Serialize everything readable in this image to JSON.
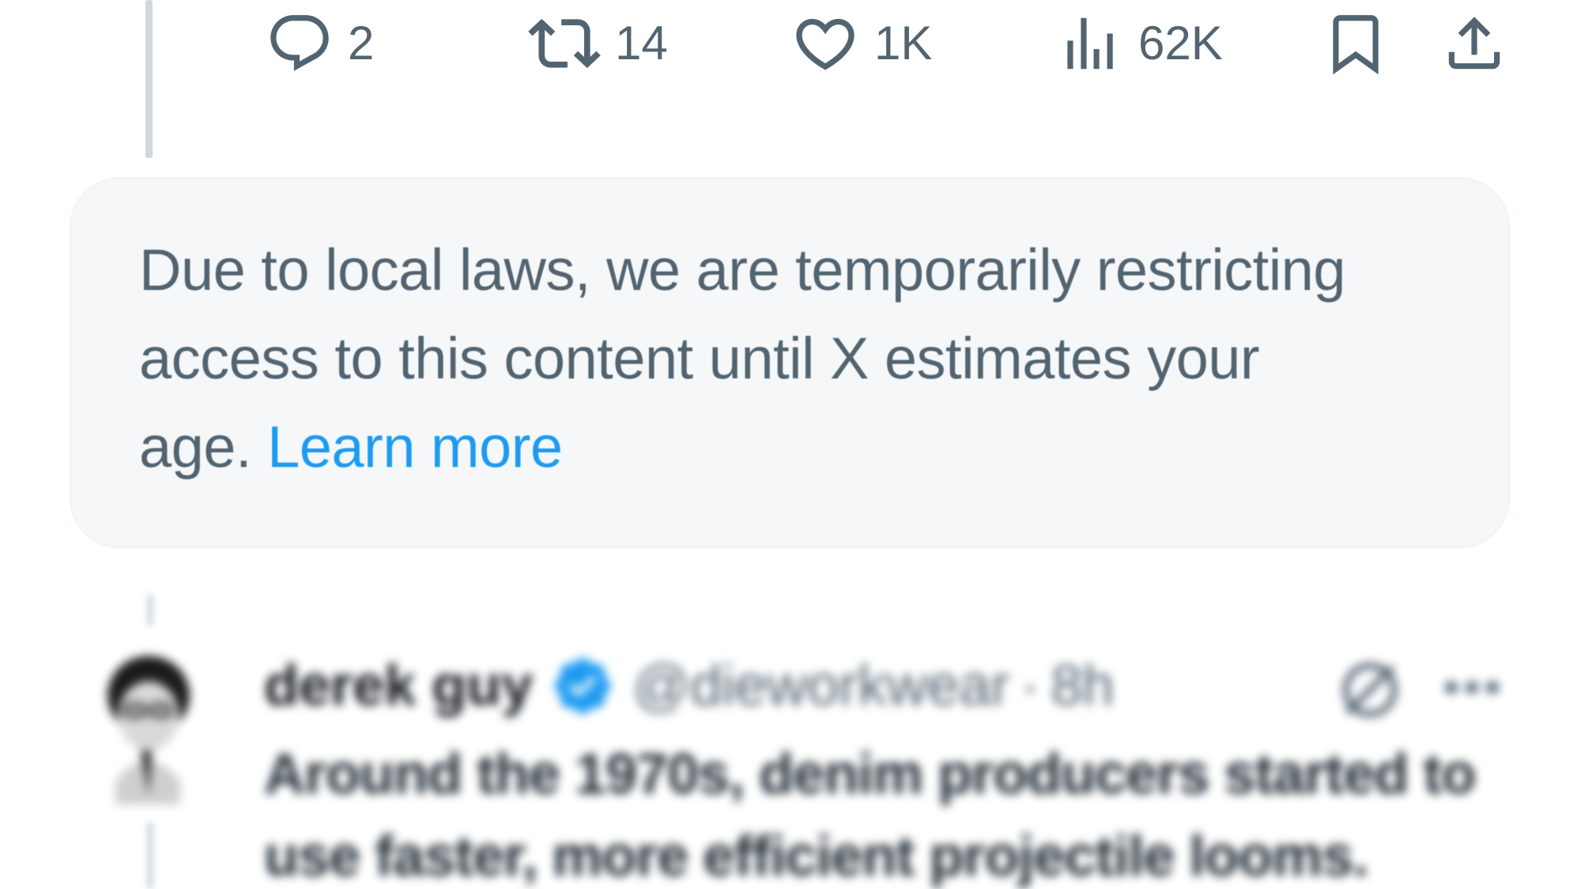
{
  "actions": {
    "reply_count": "2",
    "repost_count": "14",
    "like_count": "1K",
    "views_count": "62K"
  },
  "notice": {
    "text": "Due to local laws, we are temporarily restricting access to this content until X estimates your age.",
    "link_label": "Learn more"
  },
  "reply_tweet": {
    "display_name": "derek guy",
    "handle": "@dieworkwear",
    "separator": "·",
    "time": "8h",
    "body": "Around the 1970s, denim producers started to use faster, more efficient projectile looms."
  },
  "colors": {
    "icon_gray": "#536471",
    "link_blue": "#1d9bf0",
    "notice_bg": "#f5f7f8",
    "verified_blue": "#1d9bf0"
  },
  "icons": [
    "reply-icon",
    "repost-icon",
    "like-icon",
    "views-icon",
    "bookmark-icon",
    "share-icon",
    "verified-icon",
    "grok-icon",
    "more-icon"
  ]
}
